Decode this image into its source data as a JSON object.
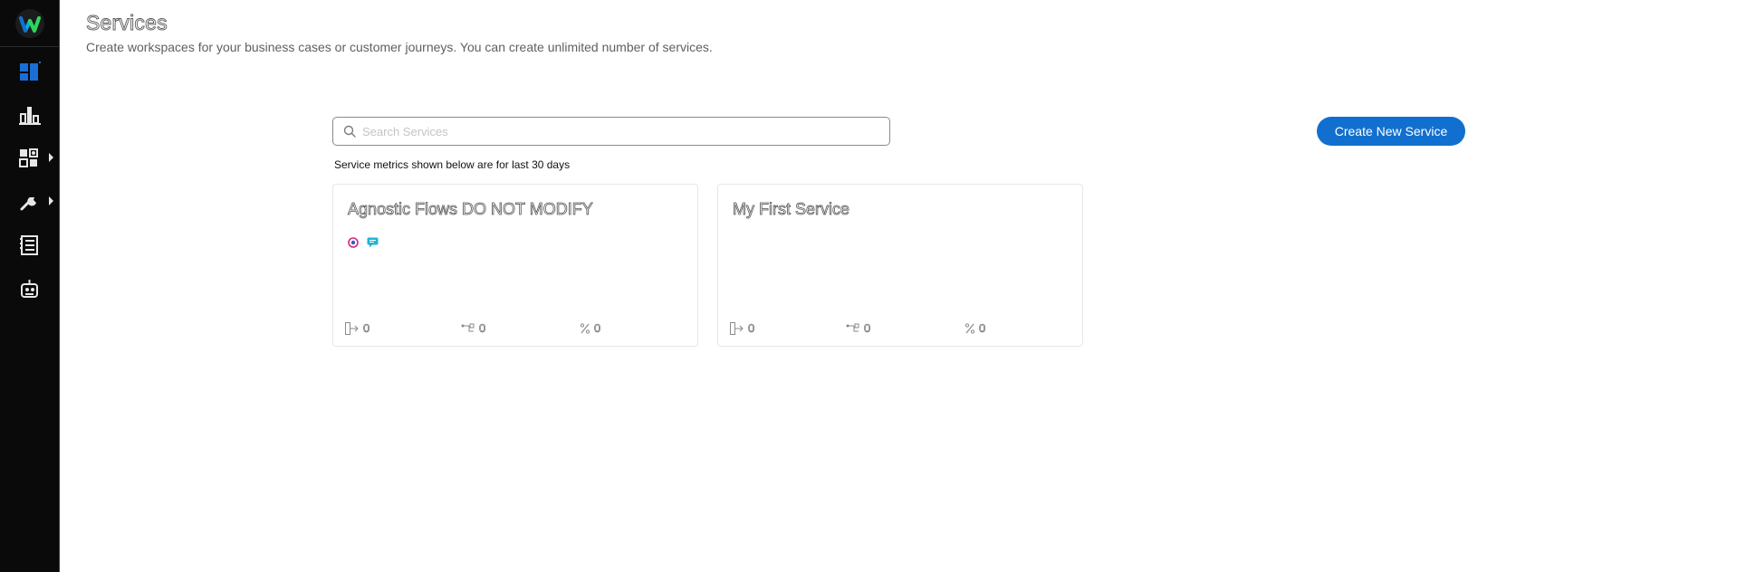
{
  "sidebar": {
    "logo": "webex-logo",
    "items": [
      {
        "icon": "dashboard-icon",
        "has_submenu": false,
        "active": true
      },
      {
        "icon": "analytics-icon",
        "has_submenu": false,
        "active": false
      },
      {
        "icon": "apps-icon",
        "has_submenu": true,
        "active": false
      },
      {
        "icon": "wrench-icon",
        "has_submenu": true,
        "active": false
      },
      {
        "icon": "flow-list-icon",
        "has_submenu": false,
        "active": false
      },
      {
        "icon": "bot-icon",
        "has_submenu": false,
        "active": false
      }
    ]
  },
  "header": {
    "title": "Services",
    "subtitle": "Create workspaces for your business cases or customer journeys. You can create unlimited number of services."
  },
  "search": {
    "placeholder": "Search Services",
    "value": ""
  },
  "create_button": {
    "label": "Create New Service"
  },
  "metrics_note": "Service metrics shown below are for last 30 days",
  "services": [
    {
      "name": "Agnostic Flows DO NOT MODIFY",
      "channels": [
        "webex-channel-icon",
        "chat-channel-icon"
      ],
      "stats": {
        "entries": "0",
        "flows": "0",
        "percent": "0"
      }
    },
    {
      "name": "My First Service",
      "channels": [],
      "stats": {
        "entries": "0",
        "flows": "0",
        "percent": "0"
      }
    }
  ],
  "colors": {
    "sidebar_bg": "#0a0a0a",
    "accent": "#1170cf",
    "active_icon": "#1a6fd6"
  }
}
